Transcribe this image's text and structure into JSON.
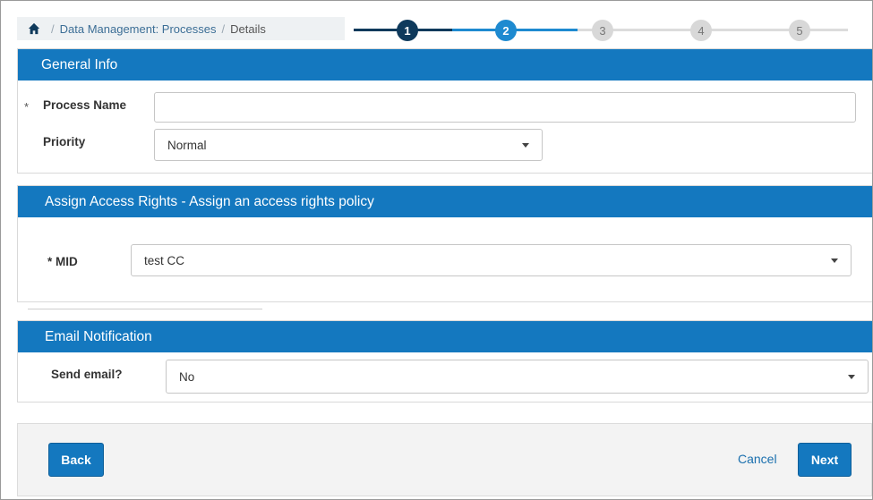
{
  "breadcrumb": {
    "home_icon": "home-icon",
    "items": [
      "Data Management: Processes",
      "Details"
    ]
  },
  "stepper": {
    "steps": [
      "1",
      "2",
      "3",
      "4",
      "5"
    ],
    "completed": 1,
    "active": 2,
    "colors": {
      "done": "#0f3a5c",
      "active": "#1e8ad0",
      "todo": "#d8d8d8"
    }
  },
  "general_info": {
    "title": "General Info",
    "process_name": {
      "required_mark": "*",
      "label": "Process Name",
      "value": ""
    },
    "priority": {
      "label": "Priority",
      "value": "Normal"
    }
  },
  "access_rights": {
    "title": "Assign Access Rights - Assign an access rights policy",
    "mid": {
      "label": "* MID",
      "value": "test CC"
    }
  },
  "email_notification": {
    "title": "Email Notification",
    "send_email": {
      "label": "Send email?",
      "value": "No"
    }
  },
  "footer": {
    "back_label": "Back",
    "cancel_label": "Cancel",
    "next_label": "Next"
  },
  "theme": {
    "accent": "#1478bf"
  }
}
